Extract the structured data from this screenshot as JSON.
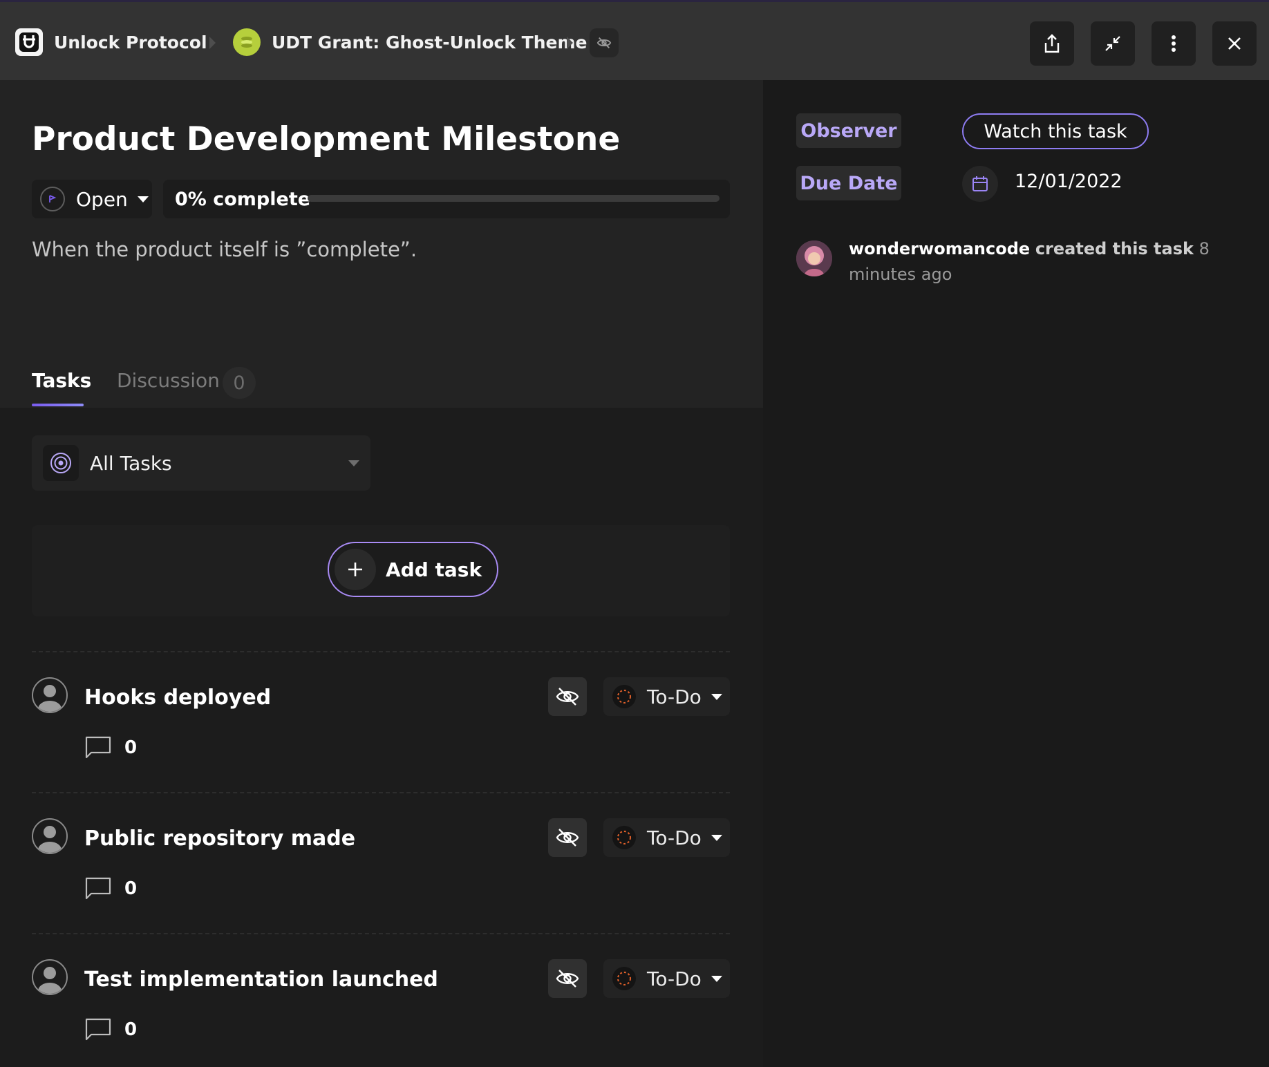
{
  "breadcrumb": {
    "org": "Unlock Protocol",
    "project": "UDT Grant: Ghost-Unlock Theme"
  },
  "task": {
    "title": "Product Development Milestone",
    "status": "Open",
    "progress_label": "0% complete",
    "progress_fraction": 0,
    "description": "When the product itself is ”complete”."
  },
  "tabs": [
    {
      "label": "Tasks"
    },
    {
      "label": "Discussion",
      "count": "0"
    }
  ],
  "filter": {
    "label": "All Tasks"
  },
  "add_task": {
    "label": "Add task"
  },
  "subtasks": [
    {
      "title": "Hooks deployed",
      "status": "To-Do",
      "comments": "0"
    },
    {
      "title": "Public repository made",
      "status": "To-Do",
      "comments": "0"
    },
    {
      "title": "Test implementation launched",
      "status": "To-Do",
      "comments": "0"
    }
  ],
  "sidebar": {
    "observer_label": "Observer",
    "watch_label": "Watch this task",
    "due_label": "Due Date",
    "due_value": "12/01/2022",
    "activity": {
      "user": "wonderwomancode",
      "action": "created this task",
      "time": "8 minutes ago"
    }
  },
  "colors": {
    "accent": "#7a5cf0",
    "label_text": "#b9a8f7",
    "project_badge": "#b6cf3c",
    "todo_dot": "#e0602a"
  },
  "icons": [
    "unlock-logo-icon",
    "project-icon",
    "hidden-eye-icon",
    "share-icon",
    "minimize-icon",
    "more-vertical-icon",
    "close-icon",
    "status-flag-icon",
    "target-icon",
    "plus-icon",
    "user-placeholder-icon",
    "todo-dot-icon",
    "comment-icon",
    "calendar-icon"
  ]
}
